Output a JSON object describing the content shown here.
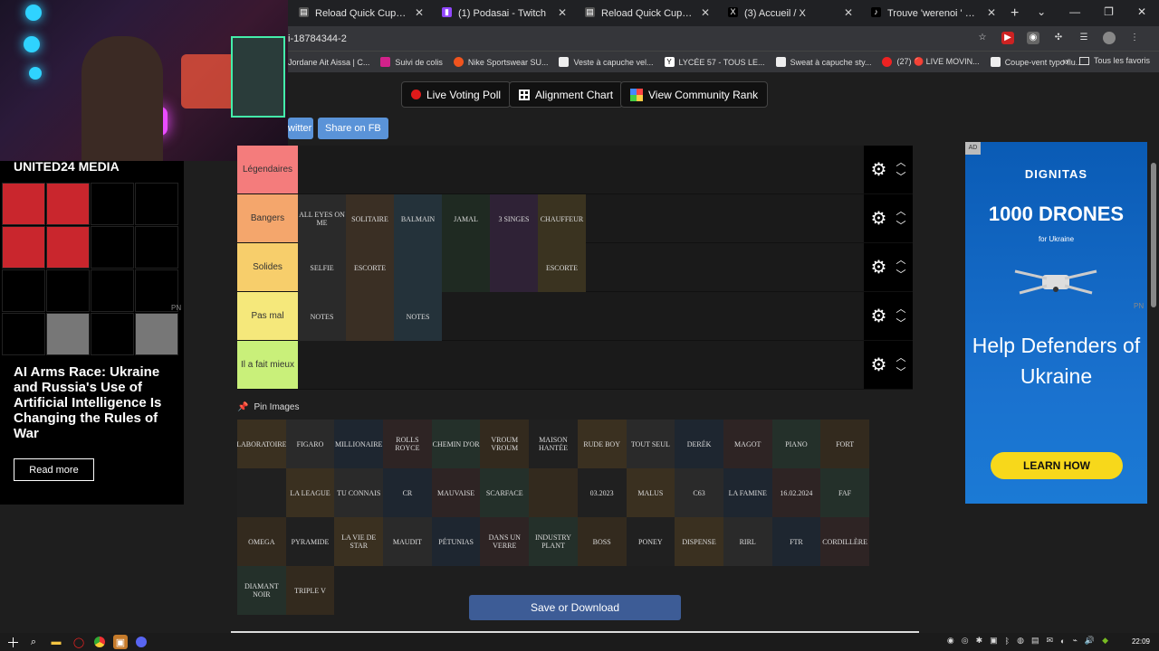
{
  "browser": {
    "tabs": [
      {
        "title": "Reload Quick Cup (Reload) in E",
        "icon": "page-icon"
      },
      {
        "title": "(1) Podasai - Twitch",
        "icon": "twitch-icon"
      },
      {
        "title": "Reload Quick Cup (Reload) in E",
        "icon": "page-icon"
      },
      {
        "title": "(3) Accueil / X",
        "icon": "x-icon"
      },
      {
        "title": "Trouve 'werenoi ' sur TikTok | R",
        "icon": "tiktok-icon"
      }
    ],
    "new_tab": "+",
    "url": "i-18784344-2",
    "bookmarks": [
      "Jordane Ait Aissa | C...",
      "Suivi de colis",
      "Nike Sportswear SU...",
      "Veste à capuche vel...",
      "LYCÉE 57 - TOUS LE...",
      "Sweat à capuche sty...",
      "(27) 🔴 LIVE MOVIN...",
      "Coupe-vent typo flu..."
    ],
    "bookmarks_more": "»",
    "all_bookmarks": "Tous les favoris"
  },
  "toolbar": {
    "live_poll": "Live Voting Poll",
    "alignment": "Alignment Chart",
    "community": "View Community Rank",
    "twitter": "witter",
    "facebook": "Share on FB"
  },
  "ad_left": {
    "brand": "UNITED24 MEDIA",
    "headline": "AI Arms Race: Ukraine and Russia's Use of Artificial Intelligence Is Changing the Rules of War",
    "button": "Read more",
    "tag": "PN"
  },
  "tiers": [
    {
      "label": "Légendaires",
      "color": "#f47c7c",
      "items": []
    },
    {
      "label": "Bangers",
      "color": "#f4a66c",
      "items": [
        "ALL EYES ON ME",
        "SOLITAIRE",
        "BALMAIN",
        "JAMAL",
        "3 SINGES",
        "CHAUFFEUR"
      ]
    },
    {
      "label": "Solides",
      "color": "#f7ce6b",
      "items": [
        "SELFIE",
        "ESCORTE",
        "",
        "",
        "",
        "ESCORTE"
      ]
    },
    {
      "label": "Pas mal",
      "color": "#f5e87b",
      "items": [
        "NOTES",
        "",
        "NOTES"
      ]
    },
    {
      "label": "Il a fait mieux",
      "color": "#c9f07a",
      "items": []
    }
  ],
  "pin_images": "Pin Images",
  "bank": [
    "LABORATOIRE",
    "FIGARO",
    "MILLIONAIRE",
    "ROLLS ROYCE",
    "CHEMIN D'OR",
    "VROUM VROUM",
    "MAISON HANTÉE",
    "RUDE BOY",
    "TOUT SEUL",
    "DERÉK",
    "MAGOT",
    "PIANO",
    "FORT",
    "",
    "LA LEAGUE",
    "TU CONNAIS",
    "CR",
    "MAUVAISE",
    "SCARFACE",
    "",
    "03.2023",
    "MALUS",
    "C63",
    "LA FAMINE",
    "16.02.2024",
    "FAF",
    "OMEGA",
    "PYRAMIDE",
    "LA VIE DE STAR",
    "MAUDIT",
    "PÉTUNIAS",
    "DANS UN VERRE",
    "INDUSTRY PLANT",
    "BOSS",
    "PONEY",
    "DISPENSE",
    "RIRL",
    "FTR",
    "CORDILLÈRE",
    "DIAMANT NOIR",
    "TRIPLE V"
  ],
  "save_button": "Save or Download",
  "ad_right": {
    "badge": "AD",
    "brand": "DIGNITAS",
    "headline": "1000 DRONES",
    "subline": "for Ukraine",
    "message": "Help Defenders of Ukraine",
    "button": "LEARN HOW",
    "tag": "PN"
  },
  "taskbar": {
    "clock": "22:09"
  }
}
